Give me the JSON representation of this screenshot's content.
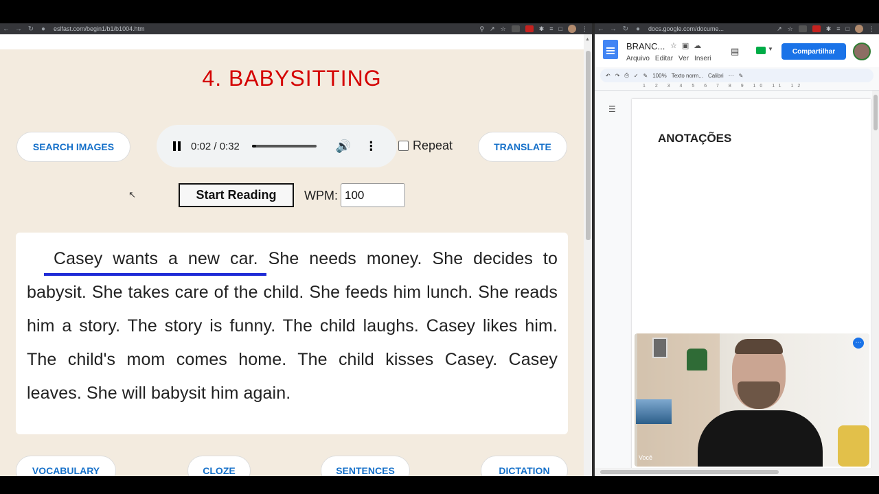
{
  "left_browser": {
    "url": "eslfast.com/begin1/b1/b1004.htm",
    "title": "4. BABYSITTING",
    "buttons": {
      "search_images": "SEARCH IMAGES",
      "translate": "TRANSLATE",
      "start_reading": "Start Reading",
      "vocabulary": "VOCABULARY",
      "cloze": "CLOZE",
      "sentences": "SENTENCES",
      "dictation": "DICTATION"
    },
    "audio": {
      "time": "0:02 / 0:32",
      "progress_fraction": 0.0625
    },
    "repeat_label": "Repeat",
    "wpm_label": "WPM:",
    "wpm_value": "100",
    "story": "Casey wants a new car. She needs money. She decides to babysit. She takes care of the child. She feeds him lunch. She reads him a story. The story is funny. The child laughs. Casey likes him. The child's mom comes home. The child kisses Casey. Casey leaves. She will babysit him again."
  },
  "right_browser": {
    "url": "docs.google.com/docume...",
    "doc_title": "BRANC...",
    "menu": [
      "Arquivo",
      "Editar",
      "Ver",
      "Inseri"
    ],
    "share_label": "Compartilhar",
    "toolbar": {
      "zoom": "100%",
      "style": "Texto norm...",
      "font": "Calibri"
    },
    "ruler": "1 2 3 4 5 6 7 8 9 10 11 12",
    "heading": "ANOTAÇÕES",
    "video_label": "Você"
  },
  "colors": {
    "title_red": "#d40000",
    "link_blue": "#1570c9",
    "page_bg": "#f3ebdf",
    "highlight_blue": "#1f2bd6",
    "share_blue": "#1a73e8"
  }
}
